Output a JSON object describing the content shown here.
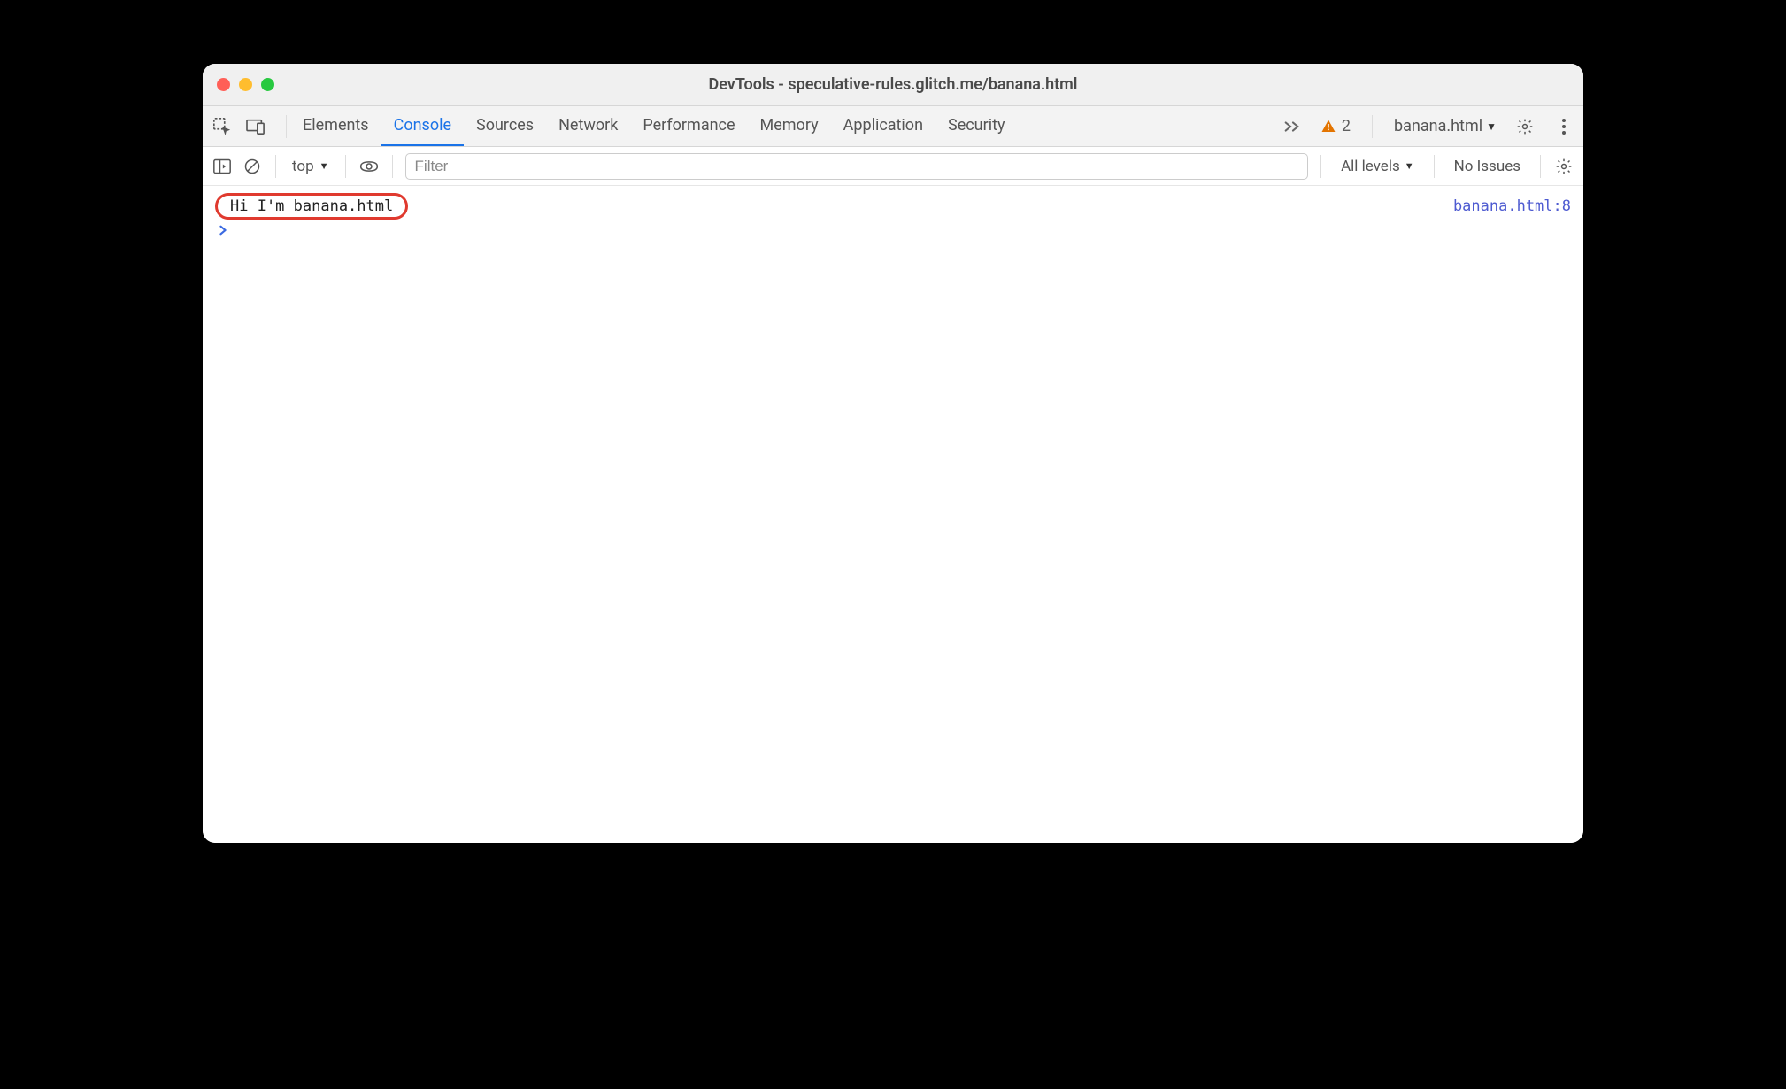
{
  "window": {
    "title": "DevTools - speculative-rules.glitch.me/banana.html"
  },
  "tabs": {
    "items": [
      "Elements",
      "Console",
      "Sources",
      "Network",
      "Performance",
      "Memory",
      "Application",
      "Security"
    ],
    "active_index": 1,
    "warning_count": "2",
    "target_label": "banana.html"
  },
  "toolbar": {
    "context_label": "top",
    "filter_placeholder": "Filter",
    "levels_label": "All levels",
    "issues_label": "No Issues"
  },
  "console": {
    "log_message": "Hi I'm banana.html",
    "source_link": "banana.html:8"
  }
}
